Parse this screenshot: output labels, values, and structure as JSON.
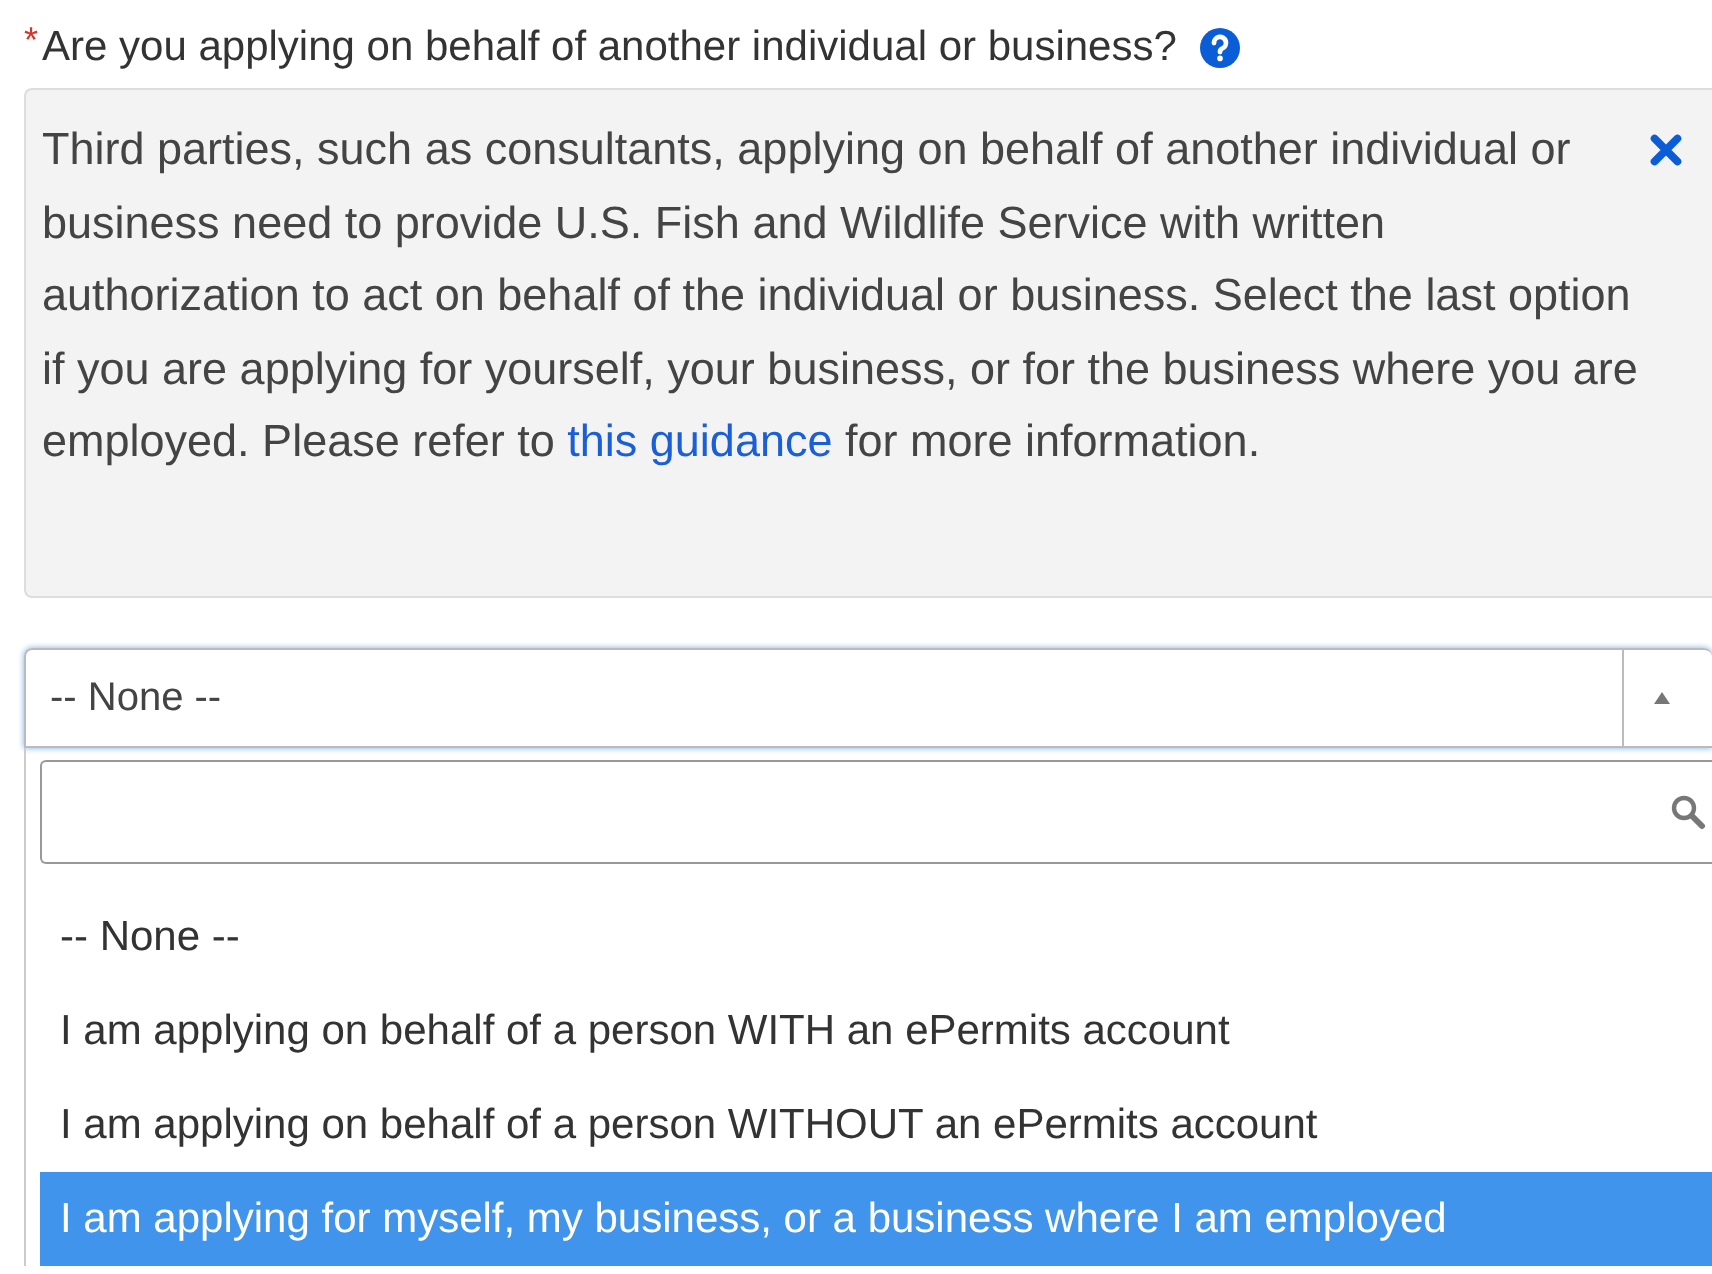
{
  "question": {
    "label": "Are you applying on behalf of another individual or business?",
    "required": true,
    "required_mark": "*"
  },
  "help": {
    "text_before": "Third parties, such as consultants, applying on behalf of another individual or business need to provide U.S. Fish and Wildlife Service with written authorization to act on behalf of the individual or business. Select the last option if you are applying for yourself, your business, or for the business where you are employed. Please refer to",
    "link": "this guidance",
    "text_after": "for more information."
  },
  "select": {
    "value": "-- None --",
    "expanded": true
  },
  "options": [
    {
      "label": "-- None --",
      "selected": false
    },
    {
      "label": "I am applying on behalf of a person WITH an ePermits account",
      "selected": false
    },
    {
      "label": "I am applying on behalf of a person WITHOUT an ePermits account",
      "selected": false
    },
    {
      "label": "I am applying for myself, my business, or a business where I am employed",
      "selected": true
    }
  ]
}
